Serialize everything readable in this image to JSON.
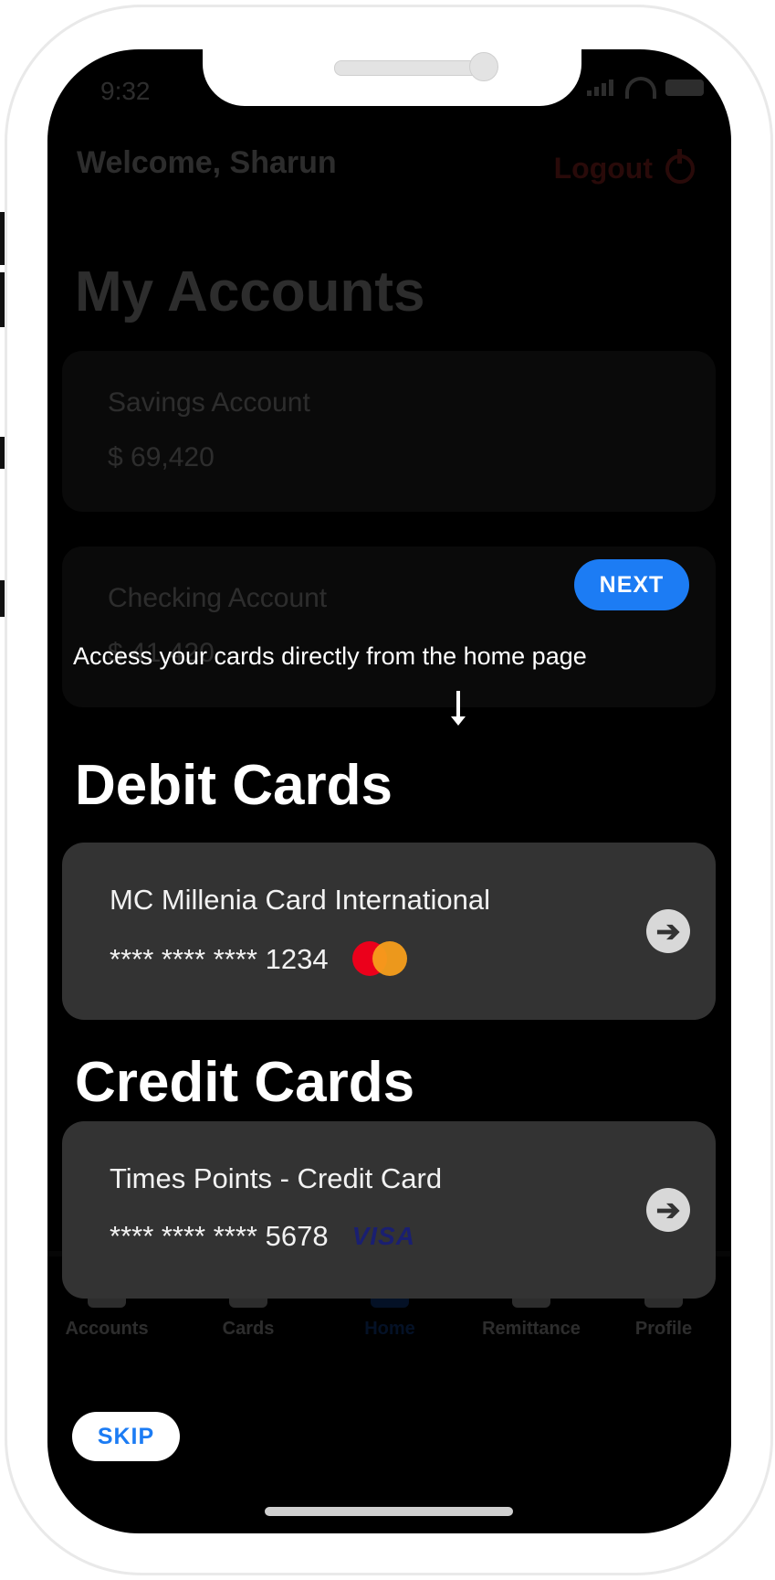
{
  "status_bar": {
    "time": "9:32"
  },
  "header": {
    "welcome": "Welcome, Sharun",
    "logout_label": "Logout"
  },
  "accounts": {
    "title": "My Accounts",
    "items": [
      {
        "name": "Savings Account",
        "balance": "$ 69,420"
      },
      {
        "name": "Checking Account",
        "balance": "$ 41,420"
      }
    ]
  },
  "debit": {
    "title": "Debit Cards",
    "card": {
      "name": "MC Millenia Card International",
      "number": "**** **** **** 1234",
      "network": "mastercard"
    }
  },
  "credit": {
    "title": "Credit Cards",
    "card": {
      "name": "Times Points - Credit Card",
      "number": "**** **** **** 5678",
      "network": "VISA"
    }
  },
  "nav": {
    "items": [
      {
        "label": "Accounts"
      },
      {
        "label": "Cards"
      },
      {
        "label": "Home",
        "active": true
      },
      {
        "label": "Remittance"
      },
      {
        "label": "Profile"
      }
    ]
  },
  "tour": {
    "next_label": "NEXT",
    "message": "Access your cards directly from the home page",
    "skip_label": "SKIP"
  },
  "colors": {
    "accent": "#1c7cf4",
    "logout": "#e53935",
    "card_bg": "#333333"
  }
}
